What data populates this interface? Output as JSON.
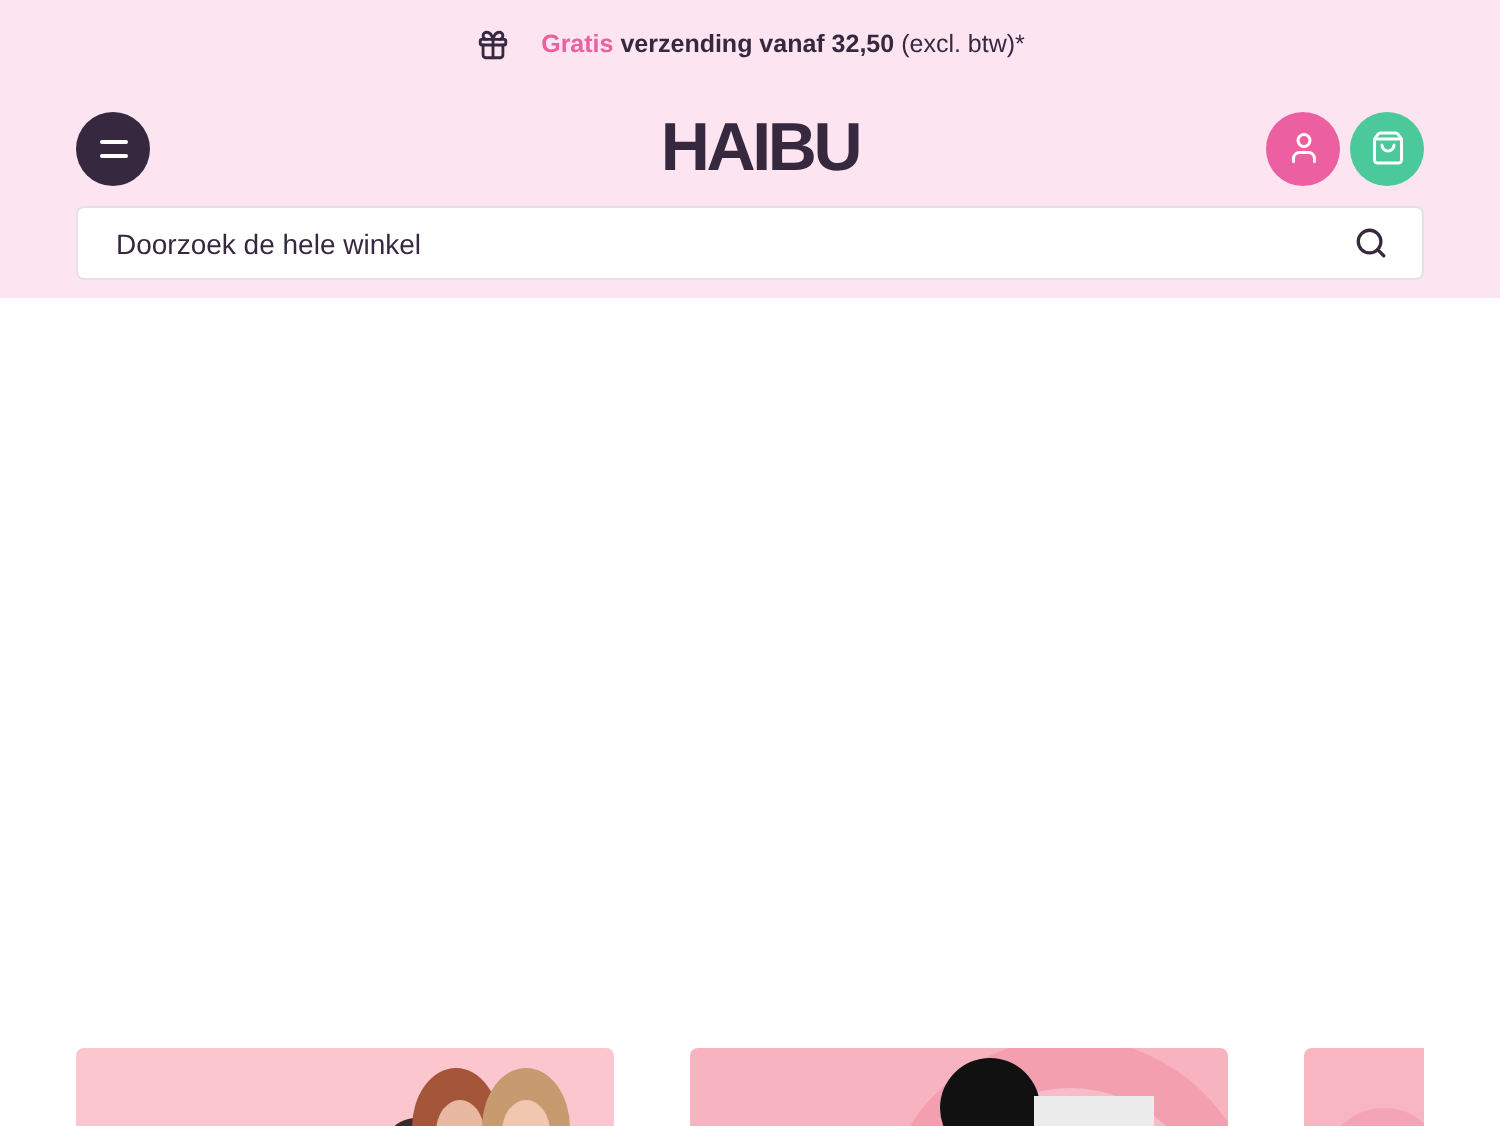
{
  "promo_bar": {
    "highlight": "Gratis",
    "text": "verzending vanaf 32,50",
    "note": "(excl. btw)*"
  },
  "header": {
    "logo": "HAIBU"
  },
  "search": {
    "placeholder": "Doorzoek de hele winkel"
  }
}
